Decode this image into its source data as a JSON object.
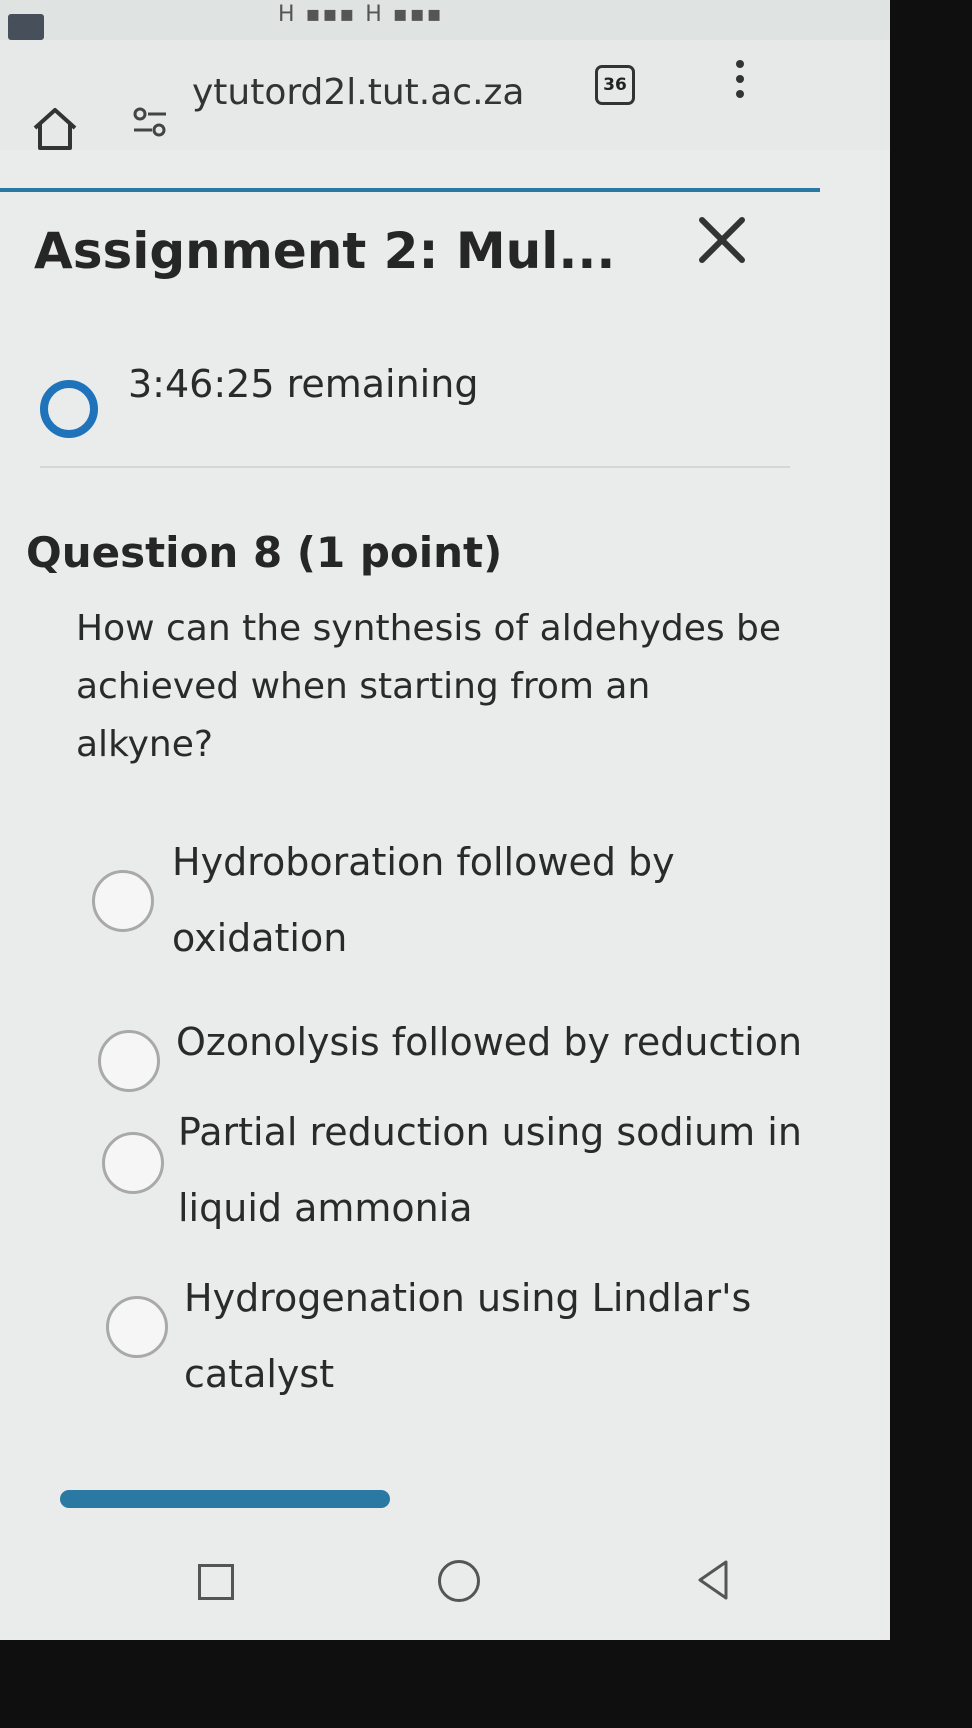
{
  "status_bar": {
    "icons_text": "H ▪▪▪ H ▪▪▪"
  },
  "browser": {
    "url": "ytutord2l.tut.ac.za",
    "tab_count": "36"
  },
  "page": {
    "title": "Assignment 2: Mul...",
    "timer": "3:46:25 remaining"
  },
  "question": {
    "heading": "Question 8 (1 point)",
    "text": "How can the synthesis of aldehydes be achieved when starting from an alkyne?",
    "options": [
      {
        "label": "Hydroboration followed by oxidation"
      },
      {
        "label": "Ozonolysis followed by reduction"
      },
      {
        "label": "Partial reduction using sodium in liquid ammonia"
      },
      {
        "label": "Hydrogenation using Lindlar's catalyst"
      }
    ]
  },
  "colors": {
    "accent": "#1e73ba",
    "progress": "#2a79a3"
  }
}
